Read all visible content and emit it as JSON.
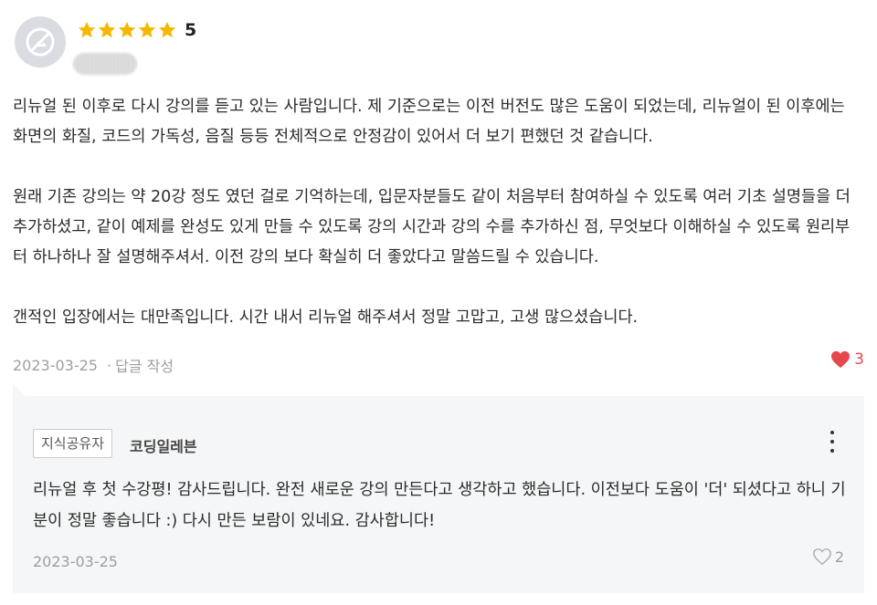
{
  "review": {
    "rating": "5",
    "stars_filled": 5,
    "star_color": "#f5b800",
    "paragraphs": [
      "리뉴얼 된 이후로 다시 강의를 듣고 있는 사람입니다. 제 기준으로는 이전 버전도 많은 도움이 되었는데, 리뉴얼이 된 이후에는 화면의 화질, 코드의 가독성, 음질 등등 전체적으로 안정감이 있어서 더 보기 편했던 것 같습니다.",
      "원래 기존 강의는 약 20강 정도 였던 걸로 기억하는데, 입문자분들도 같이 처음부터 참여하실 수 있도록 여러 기초 설명들을 더 추가하셨고, 같이 예제를 완성도 있게 만들 수 있도록 강의 시간과 강의 수를 추가하신 점, 무엇보다 이해하실 수 있도록 원리부터 하나하나 잘 설명해주셔서. 이전 강의 보다 확실히 더 좋았다고 말씀드릴 수 있습니다.",
      "갠적인 입장에서는 대만족입니다. 시간 내서 리뉴얼 해주셔서 정말 고맙고, 고생 많으셨습니다."
    ],
    "date": "2023-03-25",
    "reply_label": "답글 작성",
    "likes": "3",
    "like_color": "#e5484d"
  },
  "reply": {
    "badge": "지식공유자",
    "author": "코딩일레븐",
    "text": "리뉴얼 후 첫 수강평! 감사드립니다. 완전 새로운 강의 만든다고 생각하고 했습니다. 이전보다 도움이 '더' 되셨다고 하니 기분이 정말 좋습니다 :) 다시 만든 보람이 있네요. 감사합니다!",
    "date": "2023-03-25",
    "likes": "2"
  }
}
